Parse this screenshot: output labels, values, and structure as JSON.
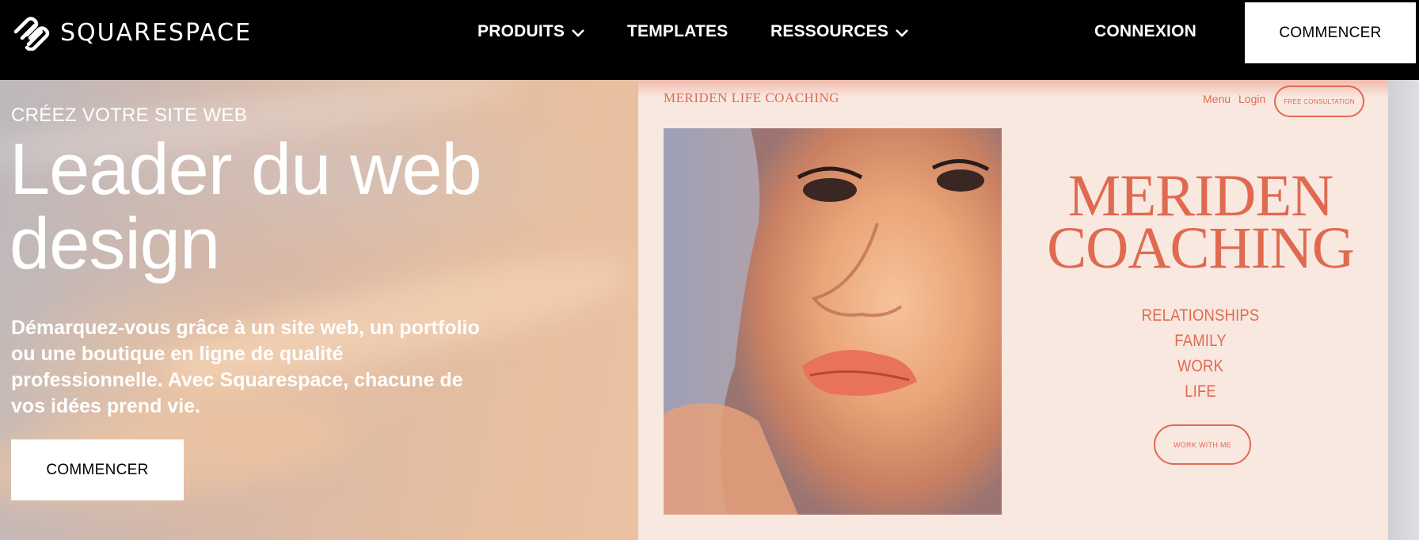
{
  "nav": {
    "logo_text": "SQUARESPACE",
    "items": [
      {
        "label": "PRODUITS",
        "has_dropdown": true
      },
      {
        "label": "TEMPLATES",
        "has_dropdown": false
      },
      {
        "label": "RESSOURCES",
        "has_dropdown": true
      }
    ],
    "login_label": "CONNEXION",
    "cta_label": "COMMENCER"
  },
  "hero": {
    "eyebrow": "CRÉEZ VOTRE SITE WEB",
    "headline_line1": "Leader du web",
    "headline_line2": "design",
    "subtext": "Démarquez-vous grâce à un site web, un portfolio ou une boutique en ligne de qualité professionnelle. Avec Squarespace, chacune de vos idées prend vie.",
    "cta_label": "COMMENCER"
  },
  "preview": {
    "brand": "MERIDEN LIFE COACHING",
    "menu_label": "Menu",
    "login_label": "Login",
    "consult_label": "FREE CONSULTATION",
    "title_line1": "MERIDEN",
    "title_line2": "COACHING",
    "list": [
      "RELATIONSHIPS",
      "FAMILY",
      "WORK",
      "LIFE"
    ],
    "work_button": "WORK WITH ME"
  },
  "colors": {
    "nav_bg": "#000000",
    "accent": "#e06a50",
    "preview_bg": "#f8e8e0"
  }
}
